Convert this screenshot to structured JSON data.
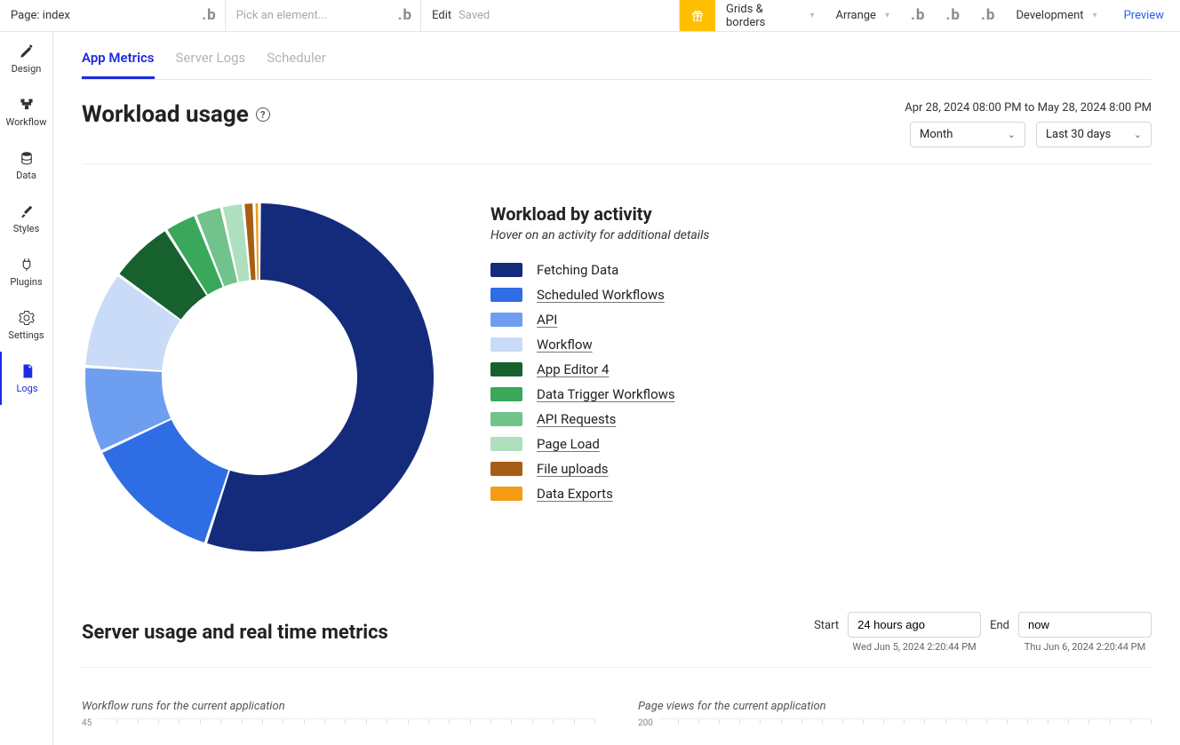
{
  "topbar": {
    "page_prefix": "Page:",
    "page_name": "index",
    "pick_placeholder": "Pick an element...",
    "edit_label": "Edit",
    "saved_label": "Saved",
    "grids_label": "Grids & borders",
    "arrange_label": "Arrange",
    "dev_label": "Development",
    "preview_label": "Preview"
  },
  "sidebar": {
    "items": [
      {
        "label": "Design",
        "icon": "design-icon"
      },
      {
        "label": "Workflow",
        "icon": "workflow-icon"
      },
      {
        "label": "Data",
        "icon": "data-icon"
      },
      {
        "label": "Styles",
        "icon": "styles-icon"
      },
      {
        "label": "Plugins",
        "icon": "plugins-icon"
      },
      {
        "label": "Settings",
        "icon": "settings-icon"
      },
      {
        "label": "Logs",
        "icon": "logs-icon"
      }
    ]
  },
  "tabs": [
    {
      "label": "App Metrics",
      "active": true
    },
    {
      "label": "Server Logs",
      "active": false
    },
    {
      "label": "Scheduler",
      "active": false
    }
  ],
  "workload": {
    "title": "Workload usage",
    "date_range": "Apr 28, 2024 08:00 PM to May 28, 2024 8:00 PM",
    "granularity": "Month",
    "period": "Last 30 days",
    "legend_title": "Workload by activity",
    "legend_sub": "Hover on an activity for additional details"
  },
  "chart_data": {
    "type": "pie",
    "title": "Workload by activity",
    "series": [
      {
        "name": "Fetching Data",
        "value": 55,
        "color": "#142b7c",
        "link": false
      },
      {
        "name": "Scheduled Workflows",
        "value": 13,
        "color": "#2f6de4",
        "link": true
      },
      {
        "name": "API",
        "value": 8,
        "color": "#6e9ef0",
        "link": true
      },
      {
        "name": "Workflow",
        "value": 9,
        "color": "#c9dbf7",
        "link": true
      },
      {
        "name": "App Editor 4",
        "value": 6,
        "color": "#17612e",
        "link": true
      },
      {
        "name": "Data Trigger Workflows",
        "value": 3,
        "color": "#39a85a",
        "link": true
      },
      {
        "name": "API Requests",
        "value": 2.5,
        "color": "#72c28b",
        "link": true
      },
      {
        "name": "Page Load",
        "value": 2,
        "color": "#aee0bf",
        "link": true
      },
      {
        "name": "File uploads",
        "value": 1,
        "color": "#a85d14",
        "link": true
      },
      {
        "name": "Data Exports",
        "value": 0.5,
        "color": "#f59b14",
        "link": true
      }
    ]
  },
  "server_metrics": {
    "title": "Server usage and real time metrics",
    "start_label": "Start",
    "start_value": "24 hours ago",
    "start_sub": "Wed Jun 5, 2024 2:20:44 PM",
    "end_label": "End",
    "end_value": "now",
    "end_sub": "Thu Jun 6, 2024 2:20:44 PM"
  },
  "mini_charts": [
    {
      "title": "Workflow runs for the current application",
      "ymax": "45"
    },
    {
      "title": "Page views for the current application",
      "ymax": "200"
    }
  ]
}
